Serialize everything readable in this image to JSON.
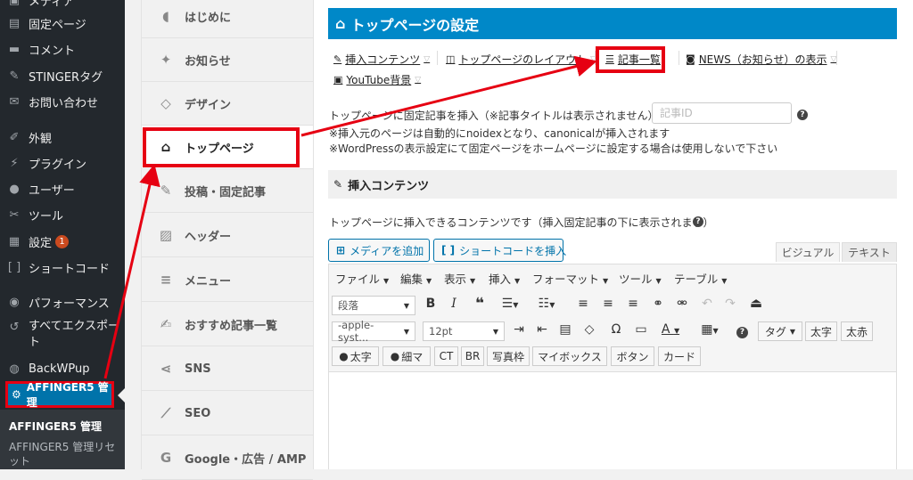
{
  "wp_sidebar": {
    "items": [
      {
        "label": "メディア",
        "icon": "media-icon"
      },
      {
        "label": "固定ページ",
        "icon": "page-icon"
      },
      {
        "label": "コメント",
        "icon": "comment-icon"
      },
      {
        "label": "STINGERタグ",
        "icon": "pin-icon"
      },
      {
        "label": "お問い合わせ",
        "icon": "mail-icon"
      },
      {
        "label": "外観",
        "icon": "brush-icon"
      },
      {
        "label": "プラグイン",
        "icon": "plugin-icon"
      },
      {
        "label": "ユーザー",
        "icon": "user-icon"
      },
      {
        "label": "ツール",
        "icon": "wrench-icon"
      },
      {
        "label": "設定",
        "icon": "settings-icon",
        "badge": "1"
      },
      {
        "label": "ショートコード",
        "icon": "bracket-icon"
      },
      {
        "label": "パフォーマンス",
        "icon": "database-icon"
      },
      {
        "label": "すべてエクスポート",
        "icon": "export-icon"
      },
      {
        "label": "BackWPup",
        "icon": "backwpup-icon"
      }
    ],
    "active": {
      "label": "AFFINGER5 管理",
      "icon": "gear-icon"
    },
    "submenu": [
      {
        "label": "AFFINGER5 管理"
      },
      {
        "label": "AFFINGER5 管理リセット"
      }
    ]
  },
  "settings_tabs": [
    {
      "label": "はじめに",
      "icon": "leaf-icon"
    },
    {
      "label": "お知らせ",
      "icon": "twitter-icon"
    },
    {
      "label": "デザイン",
      "icon": "diamond-icon"
    },
    {
      "label": "トップページ",
      "icon": "home-icon",
      "active": true
    },
    {
      "label": "投稿・固定記事",
      "icon": "edit-icon"
    },
    {
      "label": "ヘッダー",
      "icon": "image-icon"
    },
    {
      "label": "メニュー",
      "icon": "menu-icon"
    },
    {
      "label": "おすすめ記事一覧",
      "icon": "compose-icon"
    },
    {
      "label": "SNS",
      "icon": "share-icon"
    },
    {
      "label": "SEO",
      "icon": "chart-icon"
    },
    {
      "label": "Google・広告 / AMP",
      "icon": "google-icon"
    }
  ],
  "main": {
    "title": "トップページの設定",
    "sub_links": [
      {
        "label": "挿入コンテンツ",
        "icon": "edit-icon"
      },
      {
        "label": "トップページのレイアウト",
        "icon": "layout-icon"
      },
      {
        "label": "記事一覧",
        "icon": "list-icon"
      },
      {
        "label": "NEWS（お知らせ）の表示",
        "icon": "rss-icon"
      },
      {
        "label": "YouTube背景",
        "icon": "youtube-icon"
      }
    ],
    "insert_label": "トップページに固定記事を挿入（※記事タイトルは表示されません）：",
    "article_id_placeholder": "記事ID",
    "note1": "※挿入元のページは自動的にnoidexとなり、canonicalが挿入されます",
    "note2": "※WordPressの表示設定にて固定ページをホームページに設定する場合は使用しないで下さい",
    "section_title": "挿入コンテンツ",
    "section_desc": "トップページに挿入できるコンテンツです（挿入固定記事の下に表示されます）",
    "add_media": "メディアを追加",
    "insert_shortcode": "ショートコードを挿入",
    "mode_visual": "ビジュアル",
    "mode_text": "テキスト"
  },
  "editor": {
    "menubar": [
      "ファイル",
      "編集",
      "表示",
      "挿入",
      "フォーマット",
      "ツール",
      "テーブル"
    ],
    "paragraph_select": "段落",
    "font_select": "-apple-syst...",
    "size_select": "12pt",
    "tag_select": "タグ",
    "button_bold": "太字",
    "button_thin": "太赤",
    "row3_buttons": [
      "太字",
      "細マ",
      "CT",
      "BR",
      "写真枠",
      "マイボックス",
      "ボタン",
      "カード"
    ]
  }
}
